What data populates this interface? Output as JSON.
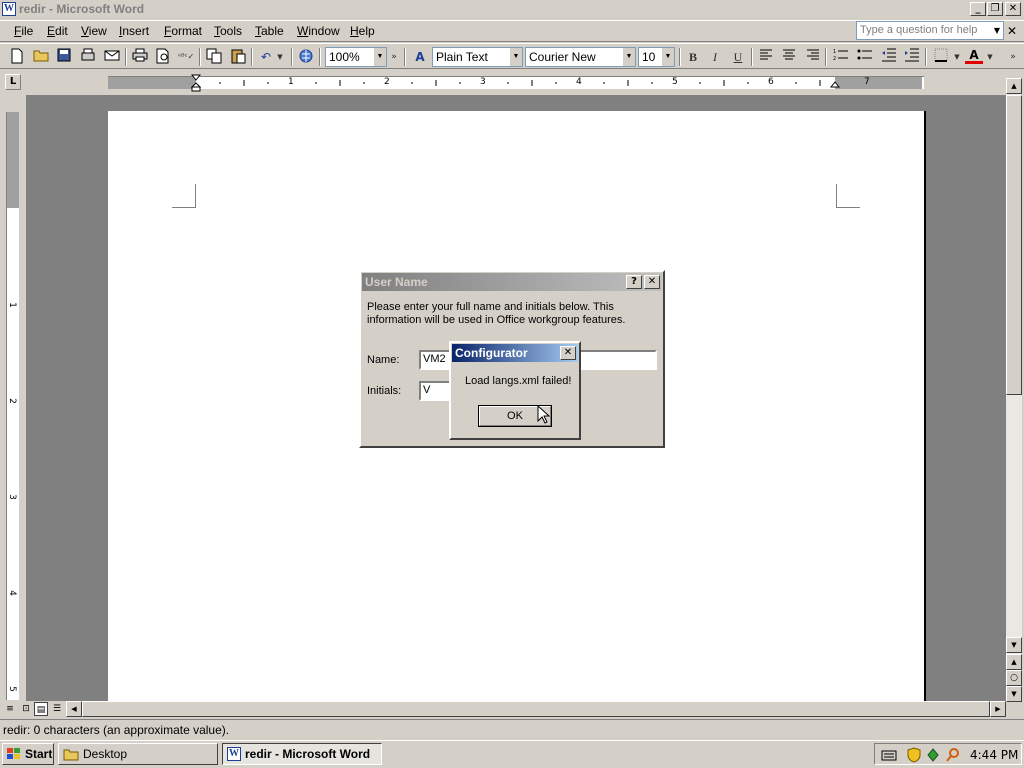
{
  "window": {
    "app_icon": "W",
    "title": "redir - Microsoft Word",
    "minimize_glyph": "_",
    "restore_glyph": "❐",
    "close_glyph": "✕"
  },
  "menu": {
    "items": [
      "File",
      "Edit",
      "View",
      "Insert",
      "Format",
      "Tools",
      "Table",
      "Window",
      "Help"
    ],
    "help_placeholder": "Type a question for help",
    "doc_close_glyph": "✕"
  },
  "toolbar": {
    "zoom": "100%",
    "style": "Plain Text",
    "font": "Courier New",
    "size": "10",
    "bold": "B",
    "italic": "I",
    "underline": "U"
  },
  "ruler": {
    "tab_selector": "L",
    "h_numbers": [
      "1",
      "2",
      "3",
      "4",
      "5",
      "6",
      "7"
    ],
    "v_numbers": [
      "1",
      "2",
      "3",
      "4",
      "5"
    ]
  },
  "status": {
    "text": "redir: 0 characters (an approximate value)."
  },
  "taskbar": {
    "start": "Start",
    "buttons": [
      "Desktop",
      "redir - Microsoft Word"
    ],
    "clock": "4:44 PM"
  },
  "user_name_dialog": {
    "title": "User Name",
    "help_glyph": "?",
    "close_glyph": "✕",
    "message": "Please enter your full name and initials below.  This information will be used in Office workgroup features.",
    "name_label": "Name:",
    "name_value": "VM2",
    "initials_label": "Initials:",
    "initials_value": "V"
  },
  "configurator_dialog": {
    "title": "Configurator",
    "close_glyph": "✕",
    "message": "Load langs.xml failed!",
    "ok": "OK"
  },
  "colors": {
    "active_caption_start": "#0a246a",
    "active_caption_end": "#a6caf0",
    "inactive_caption_start": "#808080",
    "inactive_caption_end": "#c0c0c0"
  }
}
